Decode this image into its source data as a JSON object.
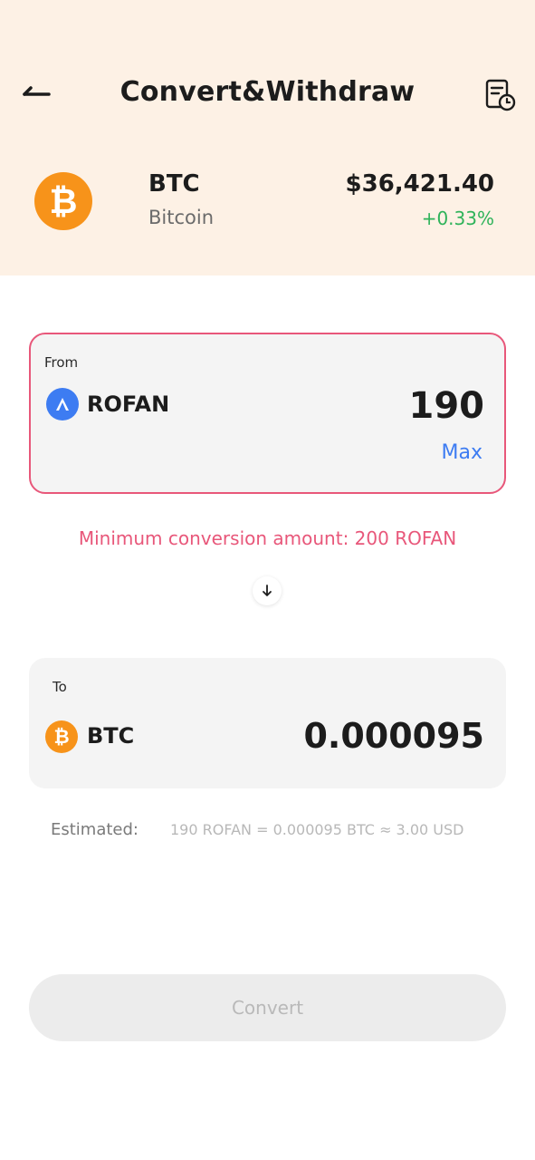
{
  "header": {
    "title": "Convert&Withdraw",
    "back_icon": "back-arrow-icon",
    "history_icon": "history-icon"
  },
  "coin": {
    "symbol": "BTC",
    "name": "Bitcoin",
    "price": "$36,421.40",
    "change": "+0.33%",
    "logo_glyph": "₿",
    "logo_color": "#f7931a",
    "change_color": "#2fb35a"
  },
  "from": {
    "label": "From",
    "token": "ROFAN",
    "amount": "190",
    "max_label": "Max",
    "border_color": "#e8577a"
  },
  "warning": "Minimum conversion amount: 200 ROFAN",
  "to": {
    "label": "To",
    "token": "BTC",
    "amount": "0.000095",
    "token_glyph": "₿"
  },
  "estimate": {
    "label": "Estimated:",
    "value": "190 ROFAN = 0.000095 BTC ≈ 3.00 USD"
  },
  "actions": {
    "convert_label": "Convert"
  },
  "colors": {
    "header_bg": "#fdf1e5",
    "accent_blue": "#3d7cf2",
    "error_pink": "#e8577a",
    "disabled_bg": "#ececec"
  }
}
